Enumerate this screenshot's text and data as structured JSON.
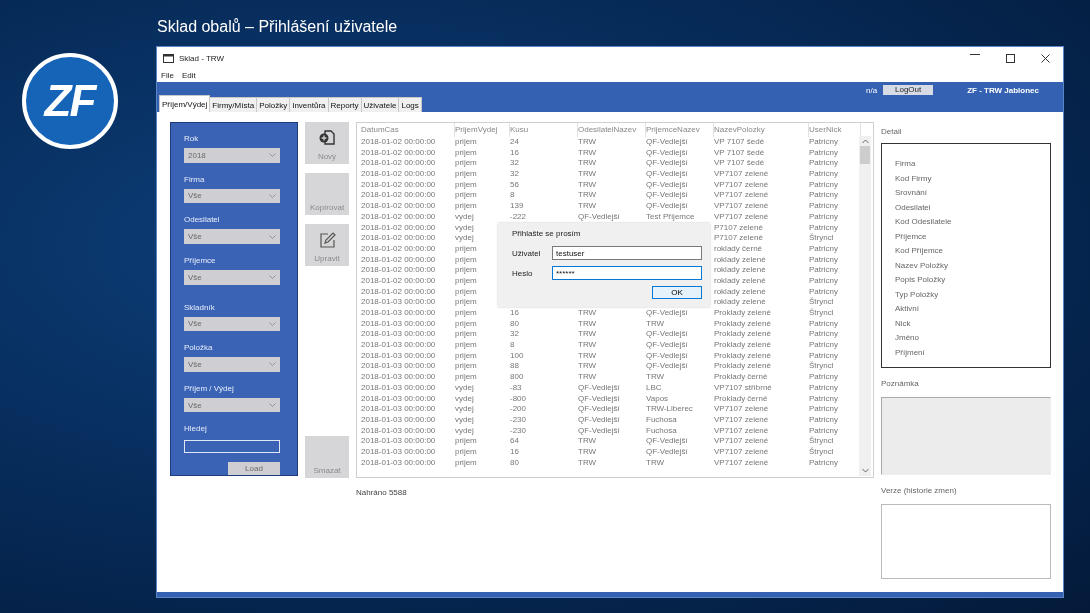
{
  "slide_title": "Sklad obalů – Přihlášení uživatele",
  "logo": "ZF",
  "window": {
    "title": "Sklad - TRW"
  },
  "menu": [
    "File",
    "Edit"
  ],
  "header": {
    "status": "n/a",
    "logout_button": "LogOut",
    "site": "ZF - TRW Jablonec"
  },
  "tabs": [
    {
      "label": "Příjem/Výdej",
      "selected": true
    },
    {
      "label": "Firmy/Místa",
      "selected": false
    },
    {
      "label": "Položky",
      "selected": false
    },
    {
      "label": "Inventůra",
      "selected": false
    },
    {
      "label": "Reporty",
      "selected": false
    },
    {
      "label": "Uživatele",
      "selected": false
    },
    {
      "label": "Logs",
      "selected": false
    }
  ],
  "filters": [
    {
      "label": "Rok",
      "value": "2018"
    },
    {
      "label": "Firma",
      "value": "Vše"
    },
    {
      "label": "Odesilatel",
      "value": "Vše"
    },
    {
      "label": "Příjemce",
      "value": "Vše"
    },
    {
      "label": "Skladník",
      "value": "Vše"
    },
    {
      "label": "Položka",
      "value": "Vše"
    },
    {
      "label": "Příjem / Výdej",
      "value": "Vše"
    }
  ],
  "search": {
    "label": "Hledej"
  },
  "load_button": "Load",
  "side_buttons": [
    {
      "label": "Nový",
      "disabled": true
    },
    {
      "label": "Kopírovat",
      "disabled": true
    },
    {
      "label": "Upravit",
      "disabled": true
    },
    {
      "label": "Smazat",
      "disabled": true
    }
  ],
  "table": {
    "columns": [
      "DatumCas",
      "PrijemVydej",
      "Kusu",
      "OdesilatelNazev",
      "PrijemceNazev",
      "NazevPolozky",
      "UserNick"
    ],
    "rows": [
      [
        "2018-01-02 00:00:00",
        "prijem",
        "24",
        "TRW",
        "QF-Vedlejší",
        "VP 7107 šedé",
        "Patricny"
      ],
      [
        "2018-01-02 00:00:00",
        "prijem",
        "16",
        "TRW",
        "QF-Vedlejší",
        "VP 7107 šedé",
        "Patricny"
      ],
      [
        "2018-01-02 00:00:00",
        "prijem",
        "32",
        "TRW",
        "QF-Vedlejší",
        "VP 7107 šedé",
        "Patricny"
      ],
      [
        "2018-01-02 00:00:00",
        "prijem",
        "32",
        "TRW",
        "QF-Vedlejší",
        "VP7107 zelené",
        "Patricny"
      ],
      [
        "2018-01-02 00:00:00",
        "prijem",
        "56",
        "TRW",
        "QF-Vedlejší",
        "VP7107 zelené",
        "Patricny"
      ],
      [
        "2018-01-02 00:00:00",
        "prijem",
        "8",
        "TRW",
        "QF-Vedlejší",
        "VP7107 zelené",
        "Patricny"
      ],
      [
        "2018-01-02 00:00:00",
        "prijem",
        "139",
        "TRW",
        "QF-Vedlejší",
        "VP7107 zelené",
        "Patricny"
      ],
      [
        "2018-01-02 00:00:00",
        "vydej",
        "-222",
        "QF-Vedlejší",
        "Test Příjemce",
        "VP7107 zelené",
        "Patricny"
      ],
      [
        "2018-01-02 00:00:00",
        "vydej",
        null,
        null,
        null,
        "P7107 zelené",
        "Patricny"
      ],
      [
        "2018-01-02 00:00:00",
        "vydej",
        null,
        null,
        null,
        "P7107 zelené",
        "Štryncl"
      ],
      [
        "2018-01-02 00:00:00",
        "prijem",
        null,
        null,
        null,
        "roklady černé",
        "Patricny"
      ],
      [
        "2018-01-02 00:00:00",
        "prijem",
        null,
        null,
        null,
        "roklady zelené",
        "Patricny"
      ],
      [
        "2018-01-02 00:00:00",
        "prijem",
        null,
        null,
        null,
        "roklady zelené",
        "Patricny"
      ],
      [
        "2018-01-02 00:00:00",
        "prijem",
        null,
        null,
        null,
        "roklady zelené",
        "Patricny"
      ],
      [
        "2018-01-02 00:00:00",
        "prijem",
        null,
        null,
        null,
        "roklady zelené",
        "Patricny"
      ],
      [
        "2018-01-03 00:00:00",
        "prijem",
        null,
        null,
        null,
        "roklady zelené",
        "Štryncl"
      ],
      [
        "2018-01-03 00:00:00",
        "prijem",
        "16",
        "TRW",
        "QF-Vedlejší",
        "Proklady zelené",
        "Štryncl"
      ],
      [
        "2018-01-03 00:00:00",
        "prijem",
        "80",
        "TRW",
        "TRW",
        "Proklady zelené",
        "Patricny"
      ],
      [
        "2018-01-03 00:00:00",
        "prijem",
        "32",
        "TRW",
        "QF-Vedlejší",
        "Proklady zelené",
        "Patricny"
      ],
      [
        "2018-01-03 00:00:00",
        "prijem",
        "8",
        "TRW",
        "QF-Vedlejší",
        "Proklady zelené",
        "Patricny"
      ],
      [
        "2018-01-03 00:00:00",
        "prijem",
        "100",
        "TRW",
        "QF-Vedlejší",
        "Proklady zelené",
        "Patricny"
      ],
      [
        "2018-01-03 00:00:00",
        "prijem",
        "88",
        "TRW",
        "QF-Vedlejší",
        "Proklady zelené",
        "Štryncl"
      ],
      [
        "2018-01-03 00:00:00",
        "prijem",
        "800",
        "TRW",
        "TRW",
        "Proklady černé",
        "Patricny"
      ],
      [
        "2018-01-03 00:00:00",
        "vydej",
        "-83",
        "QF-Vedlejší",
        "LBC",
        "VP7107 stříbrné",
        "Patricny"
      ],
      [
        "2018-01-03 00:00:00",
        "vydej",
        "-800",
        "QF-Vedlejší",
        "Vapos",
        "Proklady černé",
        "Patricny"
      ],
      [
        "2018-01-03 00:00:00",
        "vydej",
        "-200",
        "QF-Vedlejší",
        "TRW-Liberec",
        "VP7107 zelené",
        "Patricny"
      ],
      [
        "2018-01-03 00:00:00",
        "vydej",
        "-230",
        "QF-Vedlejší",
        "Fuchosa",
        "VP7107 zelené",
        "Patricny"
      ],
      [
        "2018-01-03 00:00:00",
        "vydej",
        "-230",
        "QF-Vedlejší",
        "Fuchosa",
        "VP7107 zelené",
        "Patricny"
      ],
      [
        "2018-01-03 00:00:00",
        "prijem",
        "64",
        "TRW",
        "QF-Vedlejší",
        "VP7107 zelené",
        "Štryncl"
      ],
      [
        "2018-01-03 00:00:00",
        "prijem",
        "16",
        "TRW",
        "QF-Vedlejší",
        "VP7107 zelené",
        "Štryncl"
      ],
      [
        "2018-01-03 00:00:00",
        "prijem",
        "80",
        "TRW",
        "TRW",
        "VP7107 zelené",
        "Patricny"
      ]
    ]
  },
  "status_bar": "Nahráno 5588",
  "detail": {
    "title": "Detail",
    "fields": [
      "Firma",
      "Kod Firmy",
      "Srovnání",
      "Odesilatel",
      "Kod Odesilatele",
      "Příjemce",
      "Kod Příjemce",
      "Nazev Položky",
      "Popis Položky",
      "Typ Položky",
      "Aktivní",
      "Nick",
      "Jméno",
      "Příjmení"
    ]
  },
  "note": {
    "label": "Poznámka"
  },
  "history": {
    "label": "Verze (historie zmen)"
  },
  "login_dialog": {
    "title": "Přihlašte se prosím",
    "user_label": "Uživatel",
    "user_value": "testuser",
    "password_label": "Heslo",
    "password_value": "******",
    "ok_button": "OK"
  }
}
